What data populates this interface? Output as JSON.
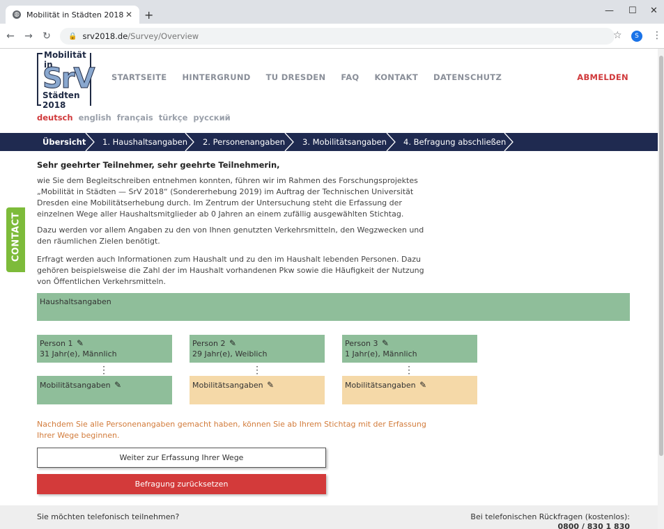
{
  "browser": {
    "tab_title": "Mobilität in Städten 2018",
    "url_host": "srv2018.de",
    "url_path": "/Survey/Overview",
    "profile_initial": "S"
  },
  "logo": {
    "line1": "Mobilität in",
    "line2": "SrV",
    "line3": "Städten 2018"
  },
  "nav": {
    "items": [
      "STARTSEITE",
      "HINTERGRUND",
      "TU DRESDEN",
      "FAQ",
      "KONTAKT",
      "DATENSCHUTZ"
    ],
    "logout": "ABMELDEN"
  },
  "languages": [
    "deutsch",
    "english",
    "français",
    "türkçe",
    "русский"
  ],
  "steps": [
    "Übersicht",
    "1. Haushaltsangaben",
    "2. Personenangaben",
    "3. Mobilitätsangaben",
    "4. Befragung abschließen"
  ],
  "content": {
    "greeting": "Sehr geehrter Teilnehmer, sehr geehrte Teilnehmerin,",
    "p1": "wie Sie dem Begleitschreiben entnehmen konnten, führen wir im Rahmen des Forschungsprojektes „Mobilität in Städten — SrV 2018“ (Sondererhebung 2019) im Auftrag der Technischen Universität Dresden eine Mobilitätserhebung durch. Im Zentrum der Untersuchung steht die Erfassung der einzelnen Wege aller Haushaltsmitglieder ab 0 Jahren an einem zufällig ausgewählten Stichtag.",
    "p2": "Dazu werden vor allem Angaben zu den von Ihnen genutzten Verkehrsmitteln, den Wegzwecken und den räumlichen Zielen benötigt.",
    "p3": "Erfragt werden auch Informationen zum Haushalt und zu den im Haushalt lebenden Personen. Dazu gehören beispielsweise die Zahl der im Haushalt vorhandenen Pkw sowie die Häufigkeit der Nutzung von Öffentlichen Verkehrsmitteln."
  },
  "contact_tab": "CONTACT",
  "household_label": "Haushaltsangaben",
  "persons": [
    {
      "name": "Person 1",
      "info": "31 Jahr(e), Männlich",
      "mobility": "Mobilitätsangaben",
      "mobility_status": "complete"
    },
    {
      "name": "Person 2",
      "info": "29 Jahr(e), Weiblich",
      "mobility": "Mobilitätsangaben",
      "mobility_status": "pending"
    },
    {
      "name": "Person 3",
      "info": "1 Jahr(e), Männlich",
      "mobility": "Mobilitätsangaben",
      "mobility_status": "pending"
    }
  ],
  "note": "Nachdem Sie alle Personenangaben gemacht haben, können Sie ab Ihrem Stichtag mit der Erfassung Ihrer Wege beginnen.",
  "buttons": {
    "continue": "Weiter zur Erfassung Ihrer Wege",
    "reset": "Befragung zurücksetzen"
  },
  "footer": {
    "left": "Sie möchten telefonisch teilnehmen?",
    "right": "Bei telefonischen Rückfragen (kostenlos):",
    "phone": "0800 / 830 1 830"
  },
  "colors": {
    "navy": "#1f2a50",
    "green_card": "#8fbe9a",
    "beige_card": "#f5d9a8",
    "red": "#d33a3a",
    "orange_note": "#d27b3a",
    "contact_green": "#7dbb3a"
  }
}
